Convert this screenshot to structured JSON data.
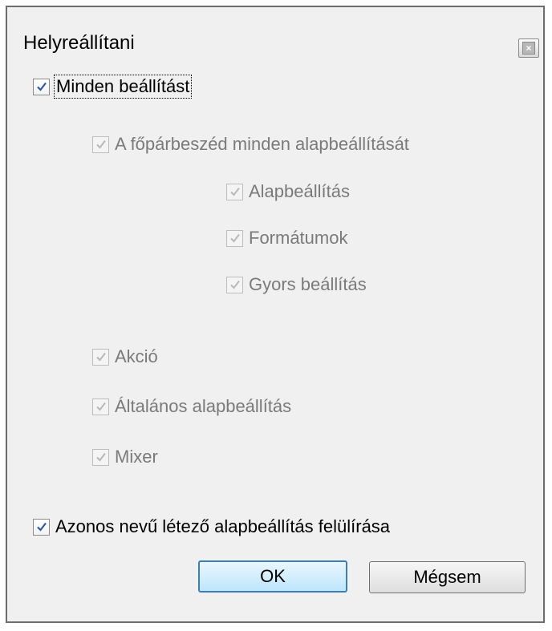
{
  "dialog": {
    "title": "Helyreállítani",
    "close_label": "×"
  },
  "options": {
    "all_settings": {
      "label": "Minden beállítást",
      "checked": true
    },
    "main_dialog_presets": {
      "label": "A főpárbeszéd minden alapbeállítását",
      "checked": true
    },
    "preset": {
      "label": "Alapbeállítás",
      "checked": true
    },
    "formats": {
      "label": "Formátumok",
      "checked": true
    },
    "quick_settings": {
      "label": "Gyors beállítás",
      "checked": true
    },
    "action": {
      "label": "Akció",
      "checked": true
    },
    "general_presets": {
      "label": "Általános alapbeállítás",
      "checked": true
    },
    "mixer": {
      "label": "Mixer",
      "checked": true
    },
    "overwrite_existing": {
      "label": "Azonos nevű létező alapbeállítás felülírása",
      "checked": true
    }
  },
  "buttons": {
    "ok": "OK",
    "cancel": "Mégsem"
  },
  "colors": {
    "window_bg": "#f0f0f0",
    "check_enabled": "#2e59a3",
    "disabled_text": "#7a7a7a",
    "default_button_border": "#3c7fb1"
  }
}
